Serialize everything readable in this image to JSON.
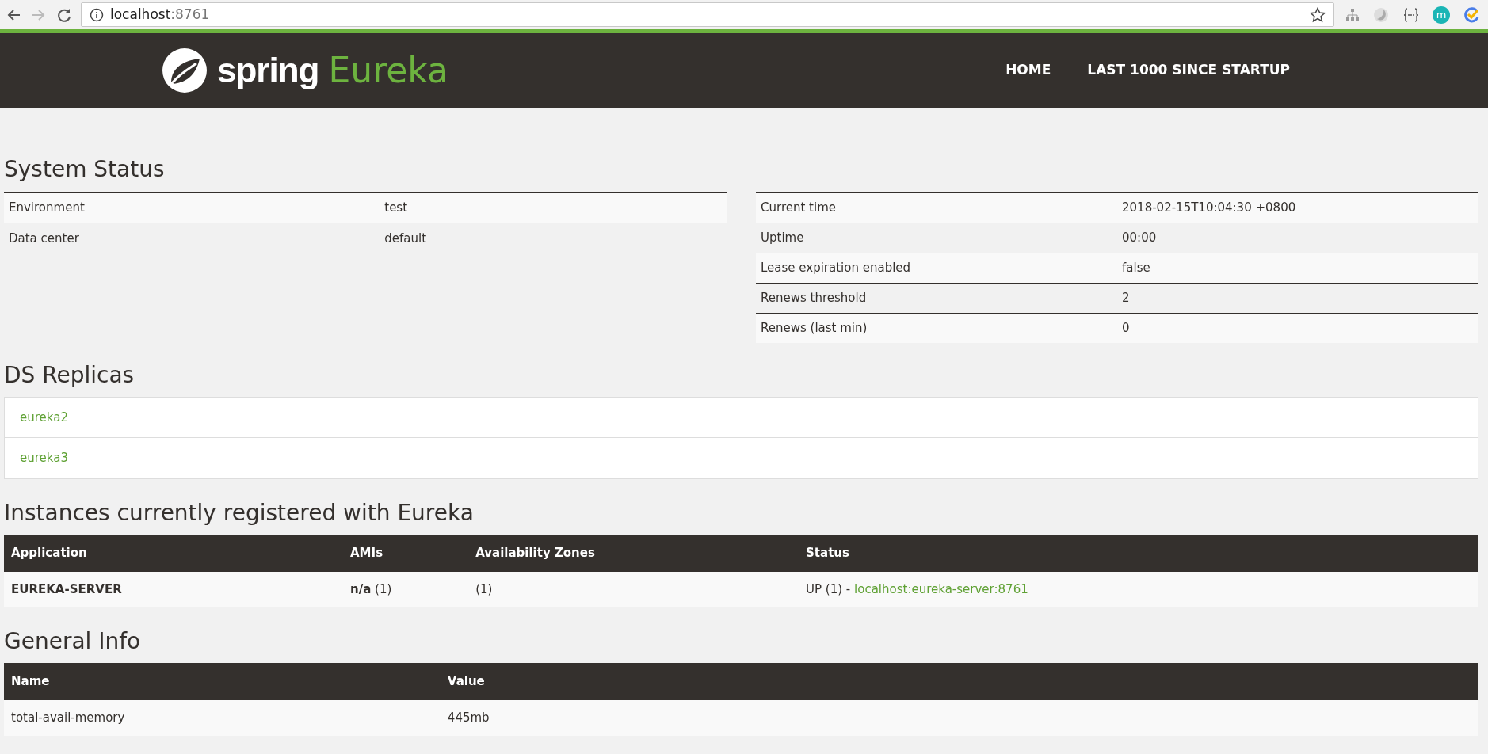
{
  "browser": {
    "address_host": "localhost",
    "address_port": ":8761",
    "extension_letter": "m"
  },
  "header": {
    "logo_first": "spring",
    "logo_second": "Eureka",
    "nav": [
      {
        "label": "HOME"
      },
      {
        "label": "LAST 1000 SINCE STARTUP"
      }
    ]
  },
  "system_status": {
    "title": "System Status",
    "left_rows": [
      {
        "label": "Environment",
        "value": "test"
      },
      {
        "label": "Data center",
        "value": "default"
      }
    ],
    "right_rows": [
      {
        "label": "Current time",
        "value": "2018-02-15T10:04:30 +0800"
      },
      {
        "label": "Uptime",
        "value": "00:00"
      },
      {
        "label": "Lease expiration enabled",
        "value": "false"
      },
      {
        "label": "Renews threshold",
        "value": "2"
      },
      {
        "label": "Renews (last min)",
        "value": "0"
      }
    ]
  },
  "ds_replicas": {
    "title": "DS Replicas",
    "items": [
      "eureka2",
      "eureka3"
    ]
  },
  "instances": {
    "title": "Instances currently registered with Eureka",
    "columns": [
      "Application",
      "AMIs",
      "Availability Zones",
      "Status"
    ],
    "rows": [
      {
        "application": "EUREKA-SERVER",
        "amis": "**n/a** (1)",
        "zones": "(1)",
        "status": "UP (1) -",
        "instance_link": "localhost:eureka-server:8761"
      }
    ]
  },
  "general_info": {
    "title": "General Info",
    "columns": [
      "Name",
      "Value"
    ],
    "rows": [
      {
        "name": "total-avail-memory",
        "value": "445mb"
      }
    ]
  }
}
